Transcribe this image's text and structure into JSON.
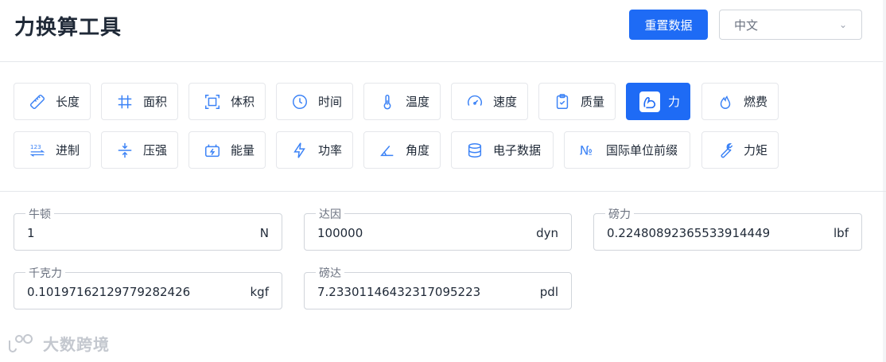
{
  "header": {
    "title": "力换算工具",
    "reset_label": "重置数据",
    "language": "中文"
  },
  "categories": [
    {
      "label": "长度",
      "icon": "ruler-icon"
    },
    {
      "label": "面积",
      "icon": "hash-grid-icon"
    },
    {
      "label": "体积",
      "icon": "frame-box-icon"
    },
    {
      "label": "时间",
      "icon": "clock-icon"
    },
    {
      "label": "温度",
      "icon": "thermometer-icon"
    },
    {
      "label": "速度",
      "icon": "speedometer-icon"
    },
    {
      "label": "质量",
      "icon": "clipboard-check-icon"
    },
    {
      "label": "力",
      "icon": "flexed-arm-icon",
      "active": true
    },
    {
      "label": "燃费",
      "icon": "flame-icon"
    },
    {
      "label": "进制",
      "icon": "number-123-icon"
    },
    {
      "label": "压强",
      "icon": "compress-icon"
    },
    {
      "label": "能量",
      "icon": "battery-charging-icon"
    },
    {
      "label": "功率",
      "icon": "lightning-icon"
    },
    {
      "label": "角度",
      "icon": "angle-icon"
    },
    {
      "label": "电子数据",
      "icon": "database-icon"
    },
    {
      "label": "国际单位前缀",
      "icon": "numero-sign-icon"
    },
    {
      "label": "力矩",
      "icon": "wrench-icon"
    }
  ],
  "fields": [
    {
      "label": "牛顿",
      "value": "1",
      "unit": "N"
    },
    {
      "label": "达因",
      "value": "100000",
      "unit": "dyn"
    },
    {
      "label": "磅力",
      "value": "0.2248089236553391444​9",
      "unit": "lbf"
    },
    {
      "label": "千克力",
      "value": "0.10197162129779282426",
      "unit": "kgf"
    },
    {
      "label": "磅达",
      "value": "7.2330114643231709522​3",
      "unit": "pdl"
    }
  ],
  "watermark": {
    "text": "大数跨境"
  },
  "colors": {
    "accent": "#1e6bf5",
    "icon_blue": "#3b82f6"
  }
}
